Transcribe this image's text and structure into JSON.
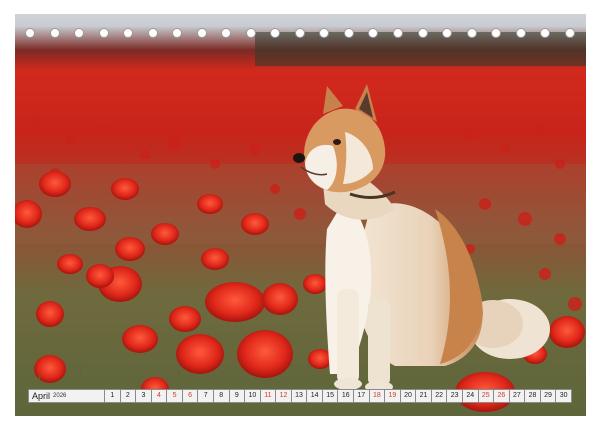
{
  "calendar": {
    "month": "April",
    "year": "2026",
    "days": [
      {
        "n": "1",
        "weekend": false
      },
      {
        "n": "2",
        "weekend": false
      },
      {
        "n": "3",
        "weekend": false
      },
      {
        "n": "4",
        "weekend": true
      },
      {
        "n": "5",
        "weekend": true
      },
      {
        "n": "6",
        "weekend": true
      },
      {
        "n": "7",
        "weekend": false
      },
      {
        "n": "8",
        "weekend": false
      },
      {
        "n": "9",
        "weekend": false
      },
      {
        "n": "10",
        "weekend": false
      },
      {
        "n": "11",
        "weekend": true
      },
      {
        "n": "12",
        "weekend": true
      },
      {
        "n": "13",
        "weekend": false
      },
      {
        "n": "14",
        "weekend": false
      },
      {
        "n": "15",
        "weekend": false
      },
      {
        "n": "16",
        "weekend": false
      },
      {
        "n": "17",
        "weekend": false
      },
      {
        "n": "18",
        "weekend": true
      },
      {
        "n": "19",
        "weekend": true
      },
      {
        "n": "20",
        "weekend": false
      },
      {
        "n": "21",
        "weekend": false
      },
      {
        "n": "22",
        "weekend": false
      },
      {
        "n": "23",
        "weekend": false
      },
      {
        "n": "24",
        "weekend": false
      },
      {
        "n": "25",
        "weekend": true
      },
      {
        "n": "26",
        "weekend": true
      },
      {
        "n": "27",
        "weekend": false
      },
      {
        "n": "28",
        "weekend": false
      },
      {
        "n": "29",
        "weekend": false
      },
      {
        "n": "30",
        "weekend": false
      }
    ]
  },
  "binding_holes": 23,
  "colors": {
    "weekend": "#d23a2a",
    "poppy": "#d8261a"
  }
}
